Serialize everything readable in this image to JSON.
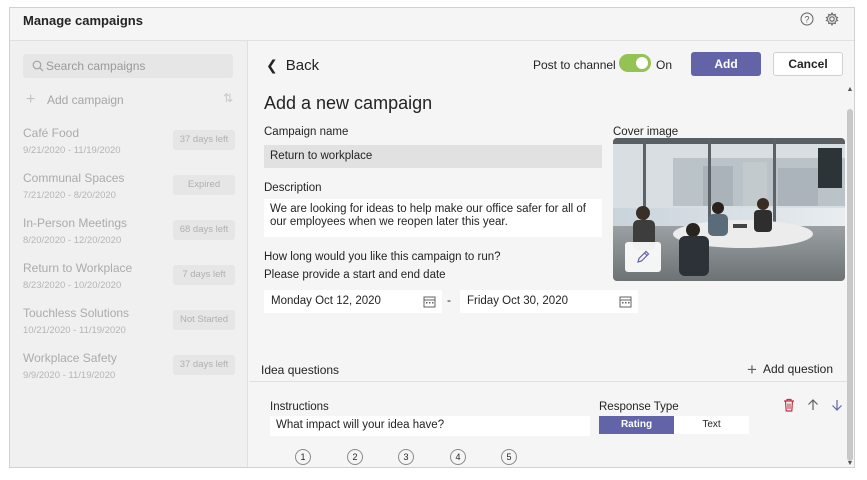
{
  "app": {
    "title": "Manage campaigns",
    "help_icon": "question-circle-icon",
    "settings_icon": "gear-icon"
  },
  "sidebar": {
    "search": {
      "placeholder": "Search campaigns"
    },
    "add_campaign_label": "Add campaign",
    "campaigns": [
      {
        "name": "Café Food",
        "dates": "9/21/2020 - 11/19/2020",
        "status": "37 days left"
      },
      {
        "name": "Communal Spaces",
        "dates": "7/21/2020 - 8/20/2020",
        "status": "Expired"
      },
      {
        "name": "In-Person Meetings",
        "dates": "8/20/2020 - 12/20/2020",
        "status": "68 days left"
      },
      {
        "name": "Return to Workplace",
        "dates": "8/23/2020 - 10/20/2020",
        "status": "7 days left"
      },
      {
        "name": "Touchless Solutions",
        "dates": "10/21/2020 - 11/19/2020",
        "status": "Not Started"
      },
      {
        "name": "Workplace Safety",
        "dates": "9/9/2020 - 11/19/2020",
        "status": "37 days left"
      }
    ]
  },
  "main": {
    "back_label": "Back",
    "post_to_channel_label": "Post to channel",
    "toggle_state": "On",
    "add_button": "Add",
    "cancel_button": "Cancel",
    "form_title": "Add a new campaign",
    "campaign_name": {
      "label": "Campaign name",
      "value": "Return to workplace"
    },
    "cover_image_label": "Cover image",
    "description": {
      "label": "Description",
      "value": "We are looking for ideas to help make our office safer for all of our employees when we reopen later this year."
    },
    "duration": {
      "question": "How long would you like this campaign to run?",
      "hint": "Please provide a start and end date",
      "start": "Monday Oct 12, 2020",
      "separator": "-",
      "end": "Friday Oct 30, 2020"
    },
    "idea_questions": {
      "header": "Idea questions",
      "add_question_label": "Add question",
      "instructions_label": "Instructions",
      "instructions_value": "What impact will your idea have?",
      "response_type_label": "Response Type",
      "response_options": [
        "Rating",
        "Text"
      ],
      "selected_response": "Rating",
      "rating_scale": [
        "1",
        "2",
        "3",
        "4",
        "5"
      ]
    }
  },
  "colors": {
    "accent": "#6264a7",
    "toggle_on": "#92c353",
    "delete": "#c4314b"
  }
}
